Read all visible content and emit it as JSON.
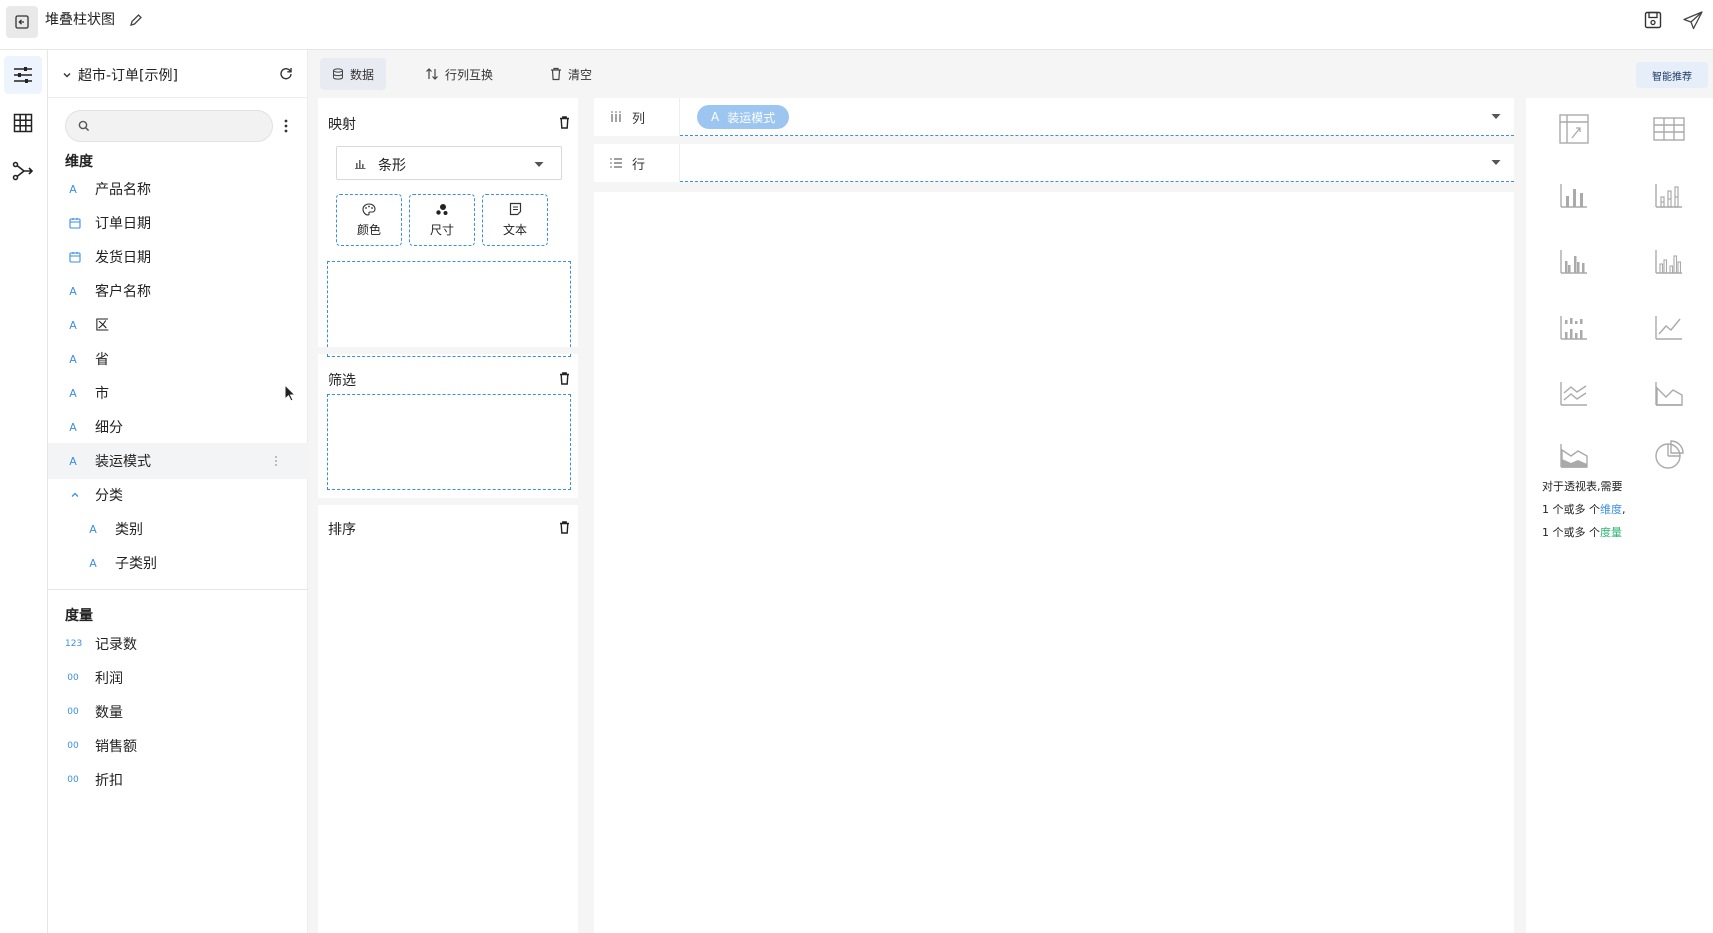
{
  "header": {
    "title": "堆叠柱状图"
  },
  "datasource": {
    "name": "超市-订单[示例]"
  },
  "search": {
    "placeholder": ""
  },
  "dimensions": {
    "title": "维度",
    "items": [
      {
        "type": "A",
        "label": "产品名称"
      },
      {
        "type": "date",
        "label": "订单日期"
      },
      {
        "type": "date",
        "label": "发货日期"
      },
      {
        "type": "A",
        "label": "客户名称"
      },
      {
        "type": "A",
        "label": "区"
      },
      {
        "type": "A",
        "label": "省"
      },
      {
        "type": "A",
        "label": "市"
      },
      {
        "type": "A",
        "label": "细分"
      },
      {
        "type": "A",
        "label": "装运模式"
      }
    ],
    "group": {
      "label": "分类",
      "children": [
        {
          "type": "A",
          "label": "类别"
        },
        {
          "type": "A",
          "label": "子类别"
        }
      ]
    }
  },
  "measures": {
    "title": "度量",
    "items": [
      {
        "type": "123",
        "label": "记录数"
      },
      {
        "type": "00",
        "label": "利润"
      },
      {
        "type": "00",
        "label": "数量"
      },
      {
        "type": "00",
        "label": "销售额"
      },
      {
        "type": "00",
        "label": "折扣"
      }
    ]
  },
  "toolbar": {
    "data_label": "数据",
    "swap_label": "行列互换",
    "clear_label": "清空",
    "smart_label": "智能推荐"
  },
  "encoding": {
    "mapping_title": "映射",
    "mark_type": "条形",
    "channels": {
      "color": "颜色",
      "size": "尺寸",
      "text": "文本"
    },
    "filter_title": "筛选",
    "sort_title": "排序"
  },
  "shelves": {
    "columns_label": "列",
    "rows_label": "行",
    "column_pill": {
      "type": "A",
      "label": "装运模式"
    }
  },
  "recommend": {
    "hint_line1": "对于透视表,需要",
    "hint_line2_a": "1 个或多 个",
    "hint_line2_dim": "维度",
    "hint_line2_b": ",",
    "hint_line3_a": "1 个或多 个",
    "hint_line3_mea": "度量"
  },
  "colors": {
    "accent": "#3b8ee6",
    "measure": "#2bb673",
    "pill": "#9cc6f0"
  }
}
